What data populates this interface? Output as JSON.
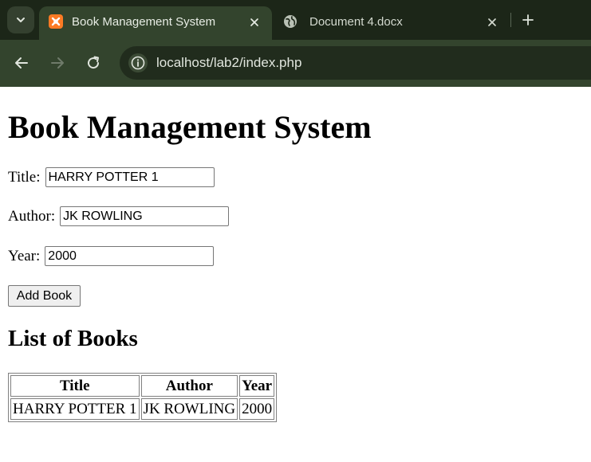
{
  "browser": {
    "tabs": [
      {
        "title": "Book Management System",
        "active": true,
        "icon": "xampp-icon"
      },
      {
        "title": "Document 4.docx",
        "active": false,
        "icon": "globe-icon"
      }
    ],
    "address": "localhost/lab2/index.php",
    "colors": {
      "frame": "#1c2618",
      "toolbar": "#33442d",
      "accent": "#fb7a24"
    }
  },
  "page": {
    "heading": "Book Management System",
    "form": {
      "title_label": "Title:",
      "title_value": "HARRY POTTER 1",
      "author_label": "Author:",
      "author_value": "JK ROWLING",
      "year_label": "Year:",
      "year_value": "2000",
      "submit_label": "Add Book"
    },
    "list_heading": "List of Books",
    "table": {
      "columns": [
        "Title",
        "Author",
        "Year"
      ],
      "rows": [
        [
          "HARRY POTTER 1",
          "JK ROWLING",
          "2000"
        ]
      ]
    }
  }
}
